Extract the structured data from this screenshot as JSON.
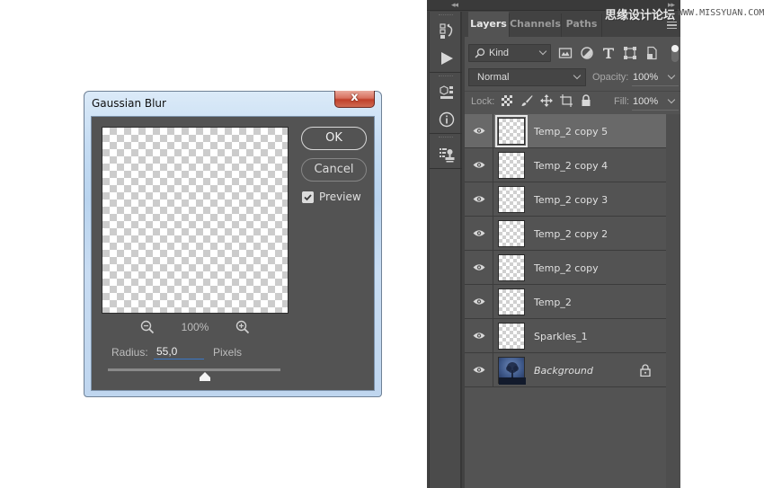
{
  "dialog": {
    "title": "Gaussian Blur",
    "close_label": "x",
    "zoom_level": "100%",
    "radius_label": "Radius:",
    "radius_value": "55,0",
    "radius_unit": "Pixels",
    "radius_slider_fraction": 0.56,
    "ok_label": "OK",
    "cancel_label": "Cancel",
    "preview_label": "Preview",
    "preview_checked": true
  },
  "dock": {
    "collapse_left": "◂◂",
    "collapse_right": "▸▸",
    "toolstrip": [
      "history-icon",
      "actions-play-icon",
      "libraries-3d-icon",
      "info-icon",
      "clone-source-icon"
    ]
  },
  "layers_panel": {
    "tabs": [
      {
        "label": "Layers",
        "active": true
      },
      {
        "label": "Channels",
        "active": false
      },
      {
        "label": "Paths",
        "active": false
      }
    ],
    "filter_kind": "Kind",
    "filter_icons": [
      "pixel-filter-icon",
      "adjustment-filter-icon",
      "type-filter-icon",
      "shape-filter-icon",
      "smart-object-filter-icon"
    ],
    "blend_mode": "Normal",
    "opacity_label": "Opacity:",
    "opacity_value": "100%",
    "lock_label": "Lock:",
    "lock_icons": [
      "lock-transparent-icon",
      "lock-image-icon",
      "lock-position-icon",
      "lock-artboard-icon",
      "lock-all-icon"
    ],
    "fill_label": "Fill:",
    "fill_value": "100%",
    "layers": [
      {
        "name": "Temp_2 copy 5",
        "visible": true,
        "selected": true,
        "locked": false,
        "thumb": "transparent"
      },
      {
        "name": "Temp_2 copy 4",
        "visible": true,
        "selected": false,
        "locked": false,
        "thumb": "transparent"
      },
      {
        "name": "Temp_2 copy 3",
        "visible": true,
        "selected": false,
        "locked": false,
        "thumb": "transparent"
      },
      {
        "name": "Temp_2 copy 2",
        "visible": true,
        "selected": false,
        "locked": false,
        "thumb": "transparent"
      },
      {
        "name": "Temp_2 copy",
        "visible": true,
        "selected": false,
        "locked": false,
        "thumb": "transparent"
      },
      {
        "name": "Temp_2",
        "visible": true,
        "selected": false,
        "locked": false,
        "thumb": "transparent"
      },
      {
        "name": "Sparkles_1",
        "visible": true,
        "selected": false,
        "locked": false,
        "thumb": "transparent"
      },
      {
        "name": "Background",
        "visible": true,
        "selected": false,
        "locked": true,
        "thumb": "photo"
      }
    ]
  },
  "watermark": {
    "site_cn": "思缘设计论坛",
    "site_url": "WWW.MISSYUAN.COM"
  }
}
